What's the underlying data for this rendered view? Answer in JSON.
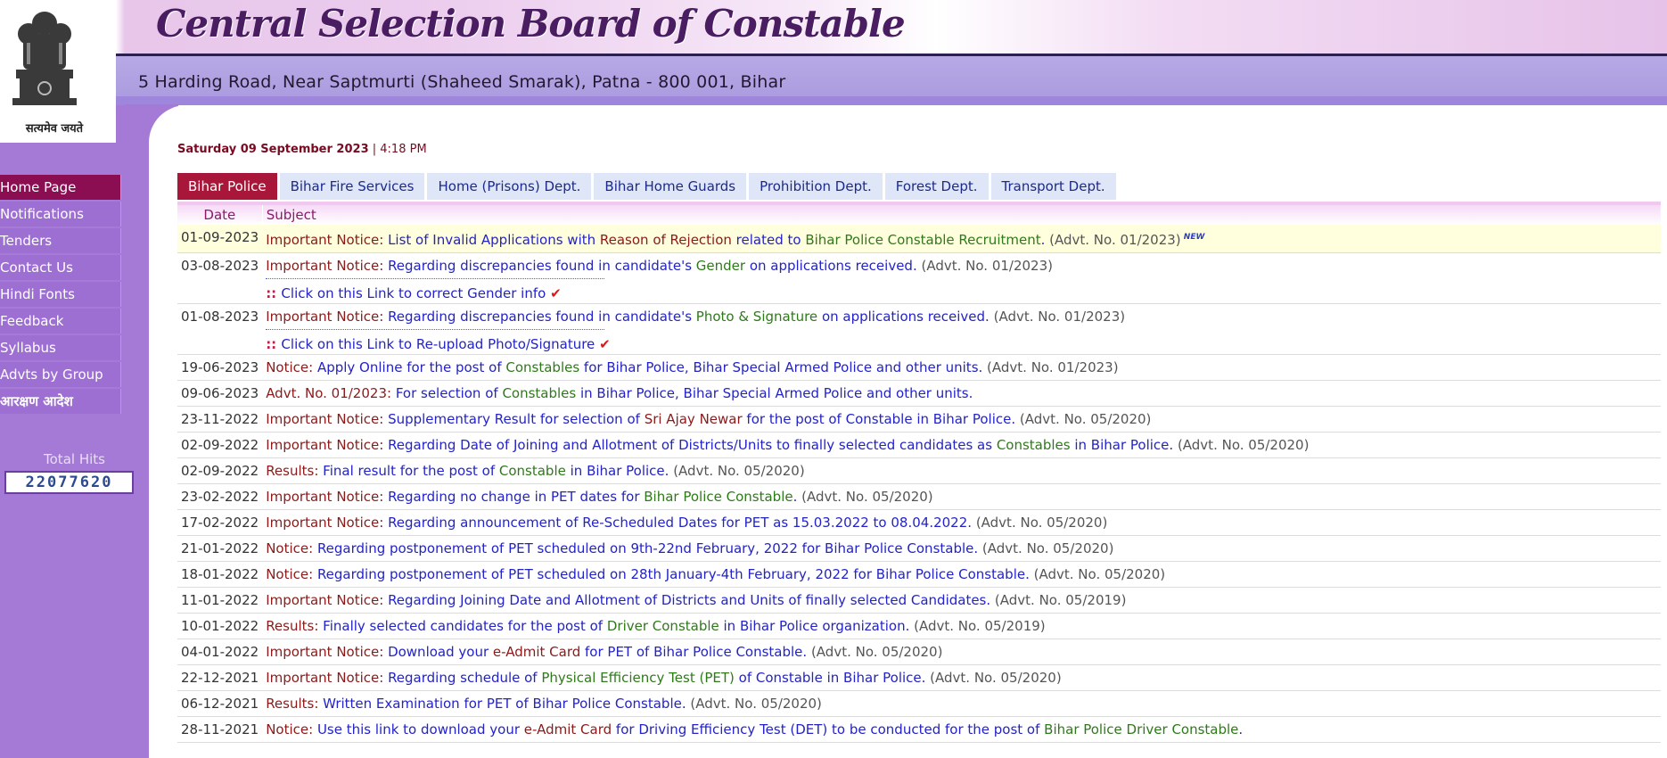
{
  "header": {
    "title": "Central Selection Board of Constable",
    "address": "5 Harding Road, Near Saptmurti (Shaheed Smarak), Patna - 800 001, Bihar",
    "motto": "सत्यमेव जयते"
  },
  "sidebar": {
    "items": [
      {
        "label": "Home Page",
        "active": true
      },
      {
        "label": "Notifications"
      },
      {
        "label": "Tenders"
      },
      {
        "label": "Contact Us"
      },
      {
        "label": "Hindi Fonts"
      },
      {
        "label": "Feedback"
      },
      {
        "label": "Syllabus"
      },
      {
        "label": "Advts by Group"
      },
      {
        "label": "आरक्षण आदेश"
      }
    ],
    "hits_label": "Total Hits",
    "hits_value": "22077620"
  },
  "datetime": {
    "date": "Saturday 09 September 2023",
    "separator": " | ",
    "time": "4:18 PM"
  },
  "tabs": [
    {
      "label": "Bihar Police",
      "active": true
    },
    {
      "label": "Bihar Fire Services"
    },
    {
      "label": "Home (Prisons) Dept."
    },
    {
      "label": "Bihar Home Guards"
    },
    {
      "label": "Prohibition Dept."
    },
    {
      "label": "Forest Dept."
    },
    {
      "label": "Transport Dept."
    }
  ],
  "table": {
    "headers": {
      "date": "Date",
      "subject": "Subject"
    },
    "new_badge": "NEW",
    "rows": [
      {
        "date": "01-09-2023",
        "highlight": true,
        "new": true,
        "parts": [
          [
            "lbl",
            "Important Notice: "
          ],
          [
            "t",
            "List of Invalid Applications with "
          ],
          [
            "m",
            "Reason of Rejection"
          ],
          [
            "t",
            " related to "
          ],
          [
            "g",
            "Bihar Police Constable Recruitment"
          ],
          [
            "t",
            ". "
          ],
          [
            "advt",
            "(Advt. No. 01/2023)"
          ]
        ]
      },
      {
        "date": "03-08-2023",
        "parts": [
          [
            "lbl",
            "Important Notice: "
          ],
          [
            "t",
            "Regarding discrepancies found in candidate's "
          ],
          [
            "g",
            "Gender"
          ],
          [
            "t",
            " on applications received. "
          ],
          [
            "advt",
            "(Advt. No. 01/2023)"
          ]
        ],
        "sublink": "Click on this Link to correct Gender info"
      },
      {
        "date": "01-08-2023",
        "parts": [
          [
            "lbl",
            "Important Notice: "
          ],
          [
            "t",
            "Regarding discrepancies found in candidate's "
          ],
          [
            "g",
            "Photo & Signature"
          ],
          [
            "t",
            " on applications received. "
          ],
          [
            "advt",
            "(Advt. No. 01/2023)"
          ]
        ],
        "sublink": "Click on this Link to Re-upload Photo/Signature"
      },
      {
        "date": "19-06-2023",
        "parts": [
          [
            "lbl",
            "Notice: "
          ],
          [
            "t",
            "Apply Online for the post of "
          ],
          [
            "g",
            "Constables"
          ],
          [
            "t",
            " for Bihar Police, Bihar Special Armed Police and other units. "
          ],
          [
            "advt",
            "(Advt. No. 01/2023)"
          ]
        ]
      },
      {
        "date": "09-06-2023",
        "parts": [
          [
            "lbl",
            "Advt. No. 01/2023: "
          ],
          [
            "t",
            "For selection of "
          ],
          [
            "g",
            "Constables"
          ],
          [
            "t",
            " in Bihar Police, Bihar Special Armed Police and other units."
          ]
        ]
      },
      {
        "date": "23-11-2022",
        "parts": [
          [
            "lbl",
            "Important Notice: "
          ],
          [
            "t",
            "Supplementary Result for selection of "
          ],
          [
            "m",
            "Sri Ajay Newar"
          ],
          [
            "t",
            " for the post of Constable in Bihar Police. "
          ],
          [
            "advt",
            "(Advt. No. 05/2020)"
          ]
        ]
      },
      {
        "date": "02-09-2022",
        "parts": [
          [
            "lbl",
            "Important Notice: "
          ],
          [
            "t",
            "Regarding Date of Joining and Allotment of Districts/Units to finally selected candidates as "
          ],
          [
            "g",
            "Constables"
          ],
          [
            "t",
            " in Bihar Police. "
          ],
          [
            "advt",
            "(Advt. No. 05/2020)"
          ]
        ]
      },
      {
        "date": "02-09-2022",
        "parts": [
          [
            "lbl",
            "Results: "
          ],
          [
            "t",
            "Final result for the post of "
          ],
          [
            "g",
            "Constable"
          ],
          [
            "t",
            " in Bihar Police. "
          ],
          [
            "advt",
            "(Advt. No. 05/2020)"
          ]
        ]
      },
      {
        "date": "23-02-2022",
        "parts": [
          [
            "lbl",
            "Important Notice: "
          ],
          [
            "t",
            "Regarding no change in PET dates for "
          ],
          [
            "g",
            "Bihar Police Constable"
          ],
          [
            "t",
            ". "
          ],
          [
            "advt",
            "(Advt. No. 05/2020)"
          ]
        ]
      },
      {
        "date": "17-02-2022",
        "parts": [
          [
            "lbl",
            "Important Notice: "
          ],
          [
            "t",
            "Regarding announcement of Re-Scheduled Dates for PET as 15.03.2022 to 08.04.2022. "
          ],
          [
            "advt",
            "(Advt. No. 05/2020)"
          ]
        ]
      },
      {
        "date": "21-01-2022",
        "parts": [
          [
            "lbl",
            "Notice: "
          ],
          [
            "t",
            "Regarding postponement of PET scheduled on 9th-22nd February, 2022 for Bihar Police Constable. "
          ],
          [
            "advt",
            "(Advt. No. 05/2020)"
          ]
        ]
      },
      {
        "date": "18-01-2022",
        "parts": [
          [
            "lbl",
            "Notice: "
          ],
          [
            "t",
            "Regarding postponement of PET scheduled on 28th January-4th February, 2022 for Bihar Police Constable. "
          ],
          [
            "advt",
            "(Advt. No. 05/2020)"
          ]
        ]
      },
      {
        "date": "11-01-2022",
        "parts": [
          [
            "lbl",
            "Important Notice: "
          ],
          [
            "t",
            "Regarding Joining Date and Allotment of Districts and Units of finally selected Candidates. "
          ],
          [
            "advt",
            "(Advt. No. 05/2019)"
          ]
        ]
      },
      {
        "date": "10-01-2022",
        "parts": [
          [
            "lbl",
            "Results: "
          ],
          [
            "t",
            "Finally selected candidates for the post of "
          ],
          [
            "g",
            "Driver Constable"
          ],
          [
            "t",
            " in Bihar Police organization. "
          ],
          [
            "advt",
            "(Advt. No. 05/2019)"
          ]
        ]
      },
      {
        "date": "04-01-2022",
        "parts": [
          [
            "lbl",
            "Important Notice: "
          ],
          [
            "t",
            "Download your "
          ],
          [
            "m",
            "e-Admit Card"
          ],
          [
            "t",
            " for PET of Bihar Police Constable. "
          ],
          [
            "advt",
            "(Advt. No. 05/2020)"
          ]
        ]
      },
      {
        "date": "22-12-2021",
        "parts": [
          [
            "lbl",
            "Important Notice: "
          ],
          [
            "t",
            "Regarding schedule of "
          ],
          [
            "g",
            "Physical Efficiency Test (PET)"
          ],
          [
            "t",
            " of Constable in Bihar Police. "
          ],
          [
            "advt",
            "(Advt. No. 05/2020)"
          ]
        ]
      },
      {
        "date": "06-12-2021",
        "parts": [
          [
            "lbl",
            "Results: "
          ],
          [
            "t",
            "Written Examination for PET of Bihar Police Constable. "
          ],
          [
            "advt",
            "(Advt. No. 05/2020)"
          ]
        ]
      },
      {
        "date": "28-11-2021",
        "parts": [
          [
            "lbl",
            "Notice: "
          ],
          [
            "t",
            "Use this link to download your "
          ],
          [
            "m",
            "e-Admit Card"
          ],
          [
            "t",
            " for Driving Efficiency Test (DET) to be conducted for the post of "
          ],
          [
            "g",
            "Bihar Police Driver Constable"
          ],
          [
            "t",
            "."
          ]
        ]
      }
    ]
  }
}
